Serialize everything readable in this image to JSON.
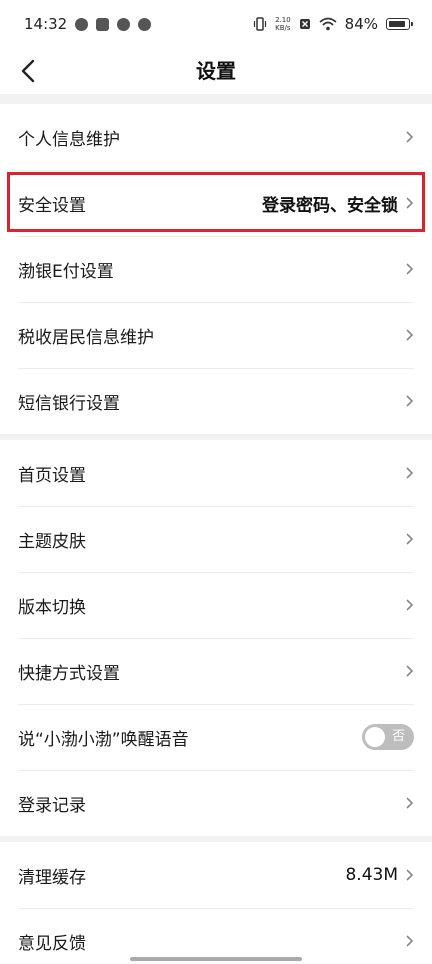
{
  "status_bar": {
    "time": "14:32",
    "net_speed_value": "2.10",
    "net_speed_unit": "KB/s",
    "battery_percent": "84%"
  },
  "header": {
    "title": "设置"
  },
  "group1": [
    {
      "label": "个人信息维护",
      "value": ""
    },
    {
      "label": "安全设置",
      "value": "登录密码、安全锁"
    },
    {
      "label": "渤银E付设置",
      "value": ""
    },
    {
      "label": "税收居民信息维护",
      "value": ""
    },
    {
      "label": "短信银行设置",
      "value": ""
    }
  ],
  "group2": [
    {
      "label": "首页设置"
    },
    {
      "label": "主题皮肤"
    },
    {
      "label": "版本切换"
    },
    {
      "label": "快捷方式设置"
    },
    {
      "label": "说“小渤小渤”唤醒语音",
      "toggle_text": "否",
      "toggle_on": false
    },
    {
      "label": "登录记录"
    }
  ],
  "group3": [
    {
      "label": "清理缓存",
      "value": "8.43M"
    },
    {
      "label": "意见反馈",
      "value": ""
    }
  ],
  "colors": {
    "highlight_border": "#d9232e",
    "background": "#f2f2f2",
    "toggle_off": "#bdbdbd"
  }
}
